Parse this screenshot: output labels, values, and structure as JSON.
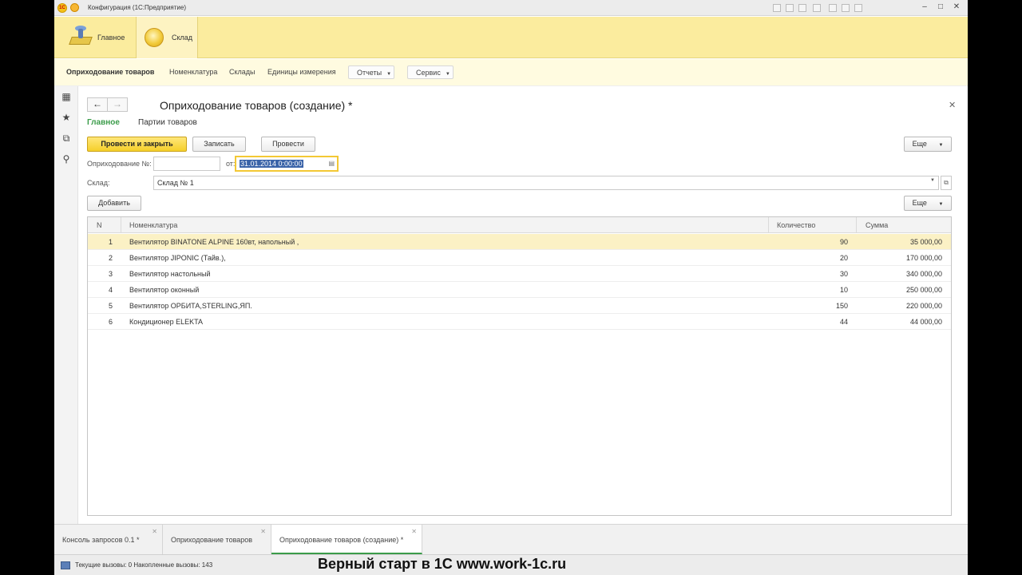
{
  "window": {
    "title": "Конфигурация  (1С:Предприятие)"
  },
  "sections": {
    "main_label": "Главное",
    "sklad_label": "Склад"
  },
  "nav": {
    "items": [
      "Оприходование товаров",
      "Номенклатура",
      "Склады",
      "Единицы измерения"
    ],
    "reports_label": "Отчеты",
    "service_label": "Сервис"
  },
  "form": {
    "title": "Оприходование товаров (создание) *",
    "tabs": [
      "Главное",
      "Партии товаров"
    ],
    "buttons": {
      "post_close": "Провести и закрыть",
      "save": "Записать",
      "post": "Провести",
      "more": "Еще",
      "add": "Добавить",
      "more2": "Еще"
    },
    "fields": {
      "number_label": "Оприходование №:",
      "number_value": "",
      "date_label": "от:",
      "date_value": "31.01.2014  0:00:00",
      "warehouse_label": "Склад:",
      "warehouse_value": "Склад № 1"
    },
    "table": {
      "columns": [
        "N",
        "Номенклатура",
        "Количество",
        "Сумма"
      ],
      "rows": [
        {
          "n": "1",
          "item": "Вентилятор BINATONE ALPINE 160вт, напольный ,",
          "qty": "90",
          "sum": "35 000,00"
        },
        {
          "n": "2",
          "item": "Вентилятор JIPONIC (Тайв.),",
          "qty": "20",
          "sum": "170 000,00"
        },
        {
          "n": "3",
          "item": "Вентилятор настольный",
          "qty": "30",
          "sum": "340 000,00"
        },
        {
          "n": "4",
          "item": "Вентилятор оконный",
          "qty": "10",
          "sum": "250 000,00"
        },
        {
          "n": "5",
          "item": "Вентилятор ОРБИТА,STERLING,ЯП.",
          "qty": "150",
          "sum": "220 000,00"
        },
        {
          "n": "6",
          "item": "Кондиционер ELEKTA",
          "qty": "44",
          "sum": "44 000,00"
        }
      ]
    }
  },
  "open_tabs": [
    {
      "label": "Консоль запросов 0.1  *"
    },
    {
      "label": "Оприходование товаров"
    },
    {
      "label": "Оприходование товаров (создание) *"
    }
  ],
  "status": {
    "text": "Текущие вызовы: 0   Накопленные вызовы: 143"
  },
  "watermark": "Верный старт в 1С www.work-1c.ru",
  "colors": {
    "sections_bg": "#fbec9e",
    "accent_green": "#3b9c4a",
    "primary_button": "#f5cf2a",
    "current_row": "#fbf1c5"
  }
}
